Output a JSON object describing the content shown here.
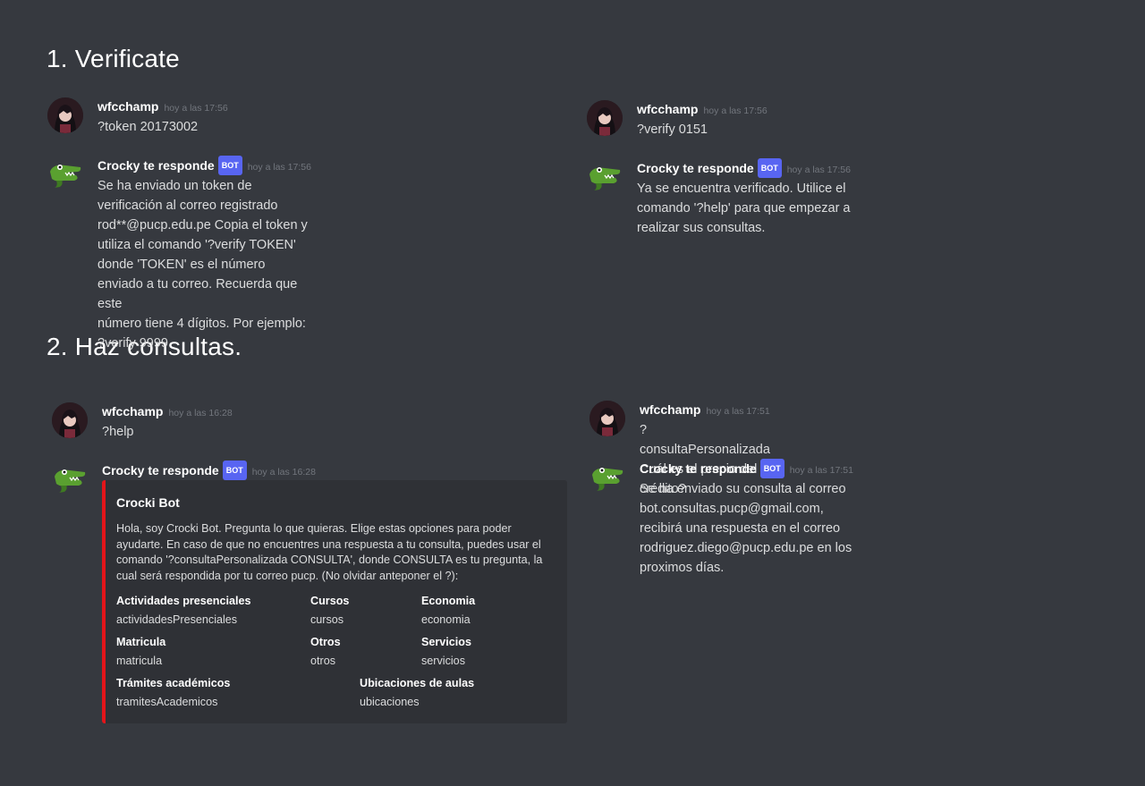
{
  "sections": [
    {
      "title": "1. Verificate"
    },
    {
      "title": "2. Haz consultas."
    }
  ],
  "user": {
    "name": "wfcchamp",
    "avatar_icon": "user-avatar-icon"
  },
  "bot": {
    "name": "Crocky te responde",
    "tag": "BOT",
    "avatar_icon": "crocodile-avatar-icon"
  },
  "colors": {
    "background": "#36393f",
    "embed_bg": "#2f3136",
    "embed_accent": "#e3151a",
    "bot_tag": "#5865f2",
    "timestamp": "#72767d"
  },
  "verify_left": {
    "user_time": "hoy a las 17:56",
    "user_text": "?token 20173002",
    "bot_time": "hoy a las 17:56",
    "bot_text": "Se ha enviado un token de verificación al correo registrado\nrod**@pucp.edu.pe Copia el token y utiliza el comando '?verify TOKEN'\ndonde 'TOKEN' es el número enviado a tu correo. Recuerda que este\nnúmero tiene 4 dígitos. Por ejemplo:\n?verify 9999"
  },
  "verify_right": {
    "user_time": "hoy a las 17:56",
    "user_text": "?verify 0151",
    "bot_time": "hoy a las 17:56",
    "bot_text": "Ya se encuentra verificado. Utilice el comando '?help' para que empezar a\nrealizar sus consultas."
  },
  "help_left": {
    "user_time": "hoy a las 16:28",
    "user_text": "?help",
    "bot_time": "hoy a las 16:28",
    "embed": {
      "title": "Crocki Bot",
      "description": "Hola, soy Crocki Bot. Pregunta lo que quieras. Elige estas opciones para poder ayudarte. En caso de que no encuentres una respuesta a tu consulta, puedes usar el comando '?consultaPersonalizada CONSULTA', donde CONSULTA es tu pregunta, la cual será respondida por tu correo pucp. (No olvidar anteponer el ?):",
      "fields": [
        {
          "name": "Actividades presenciales",
          "value": "actividadesPresenciales"
        },
        {
          "name": "Cursos",
          "value": "cursos"
        },
        {
          "name": "Economia",
          "value": "economia"
        },
        {
          "name": "Matricula",
          "value": "matricula"
        },
        {
          "name": "Otros",
          "value": "otros"
        },
        {
          "name": "Servicios",
          "value": "servicios"
        },
        {
          "name": "Trámites académicos",
          "value": "tramitesAcademicos"
        },
        {
          "name": "Ubicaciones de aulas",
          "value": "ubicaciones"
        }
      ]
    }
  },
  "consulta_right": {
    "user_time": "hoy a las 17:51",
    "user_text": "?consultaPersonalizada Cuál es el precio del crédito?",
    "bot_time": "hoy a las 17:51",
    "bot_text": "Se ha enviado su consulta al correo bot.consultas.pucp@gmail.com,\nrecibirá una respuesta en el correo rodriguez.diego@pucp.edu.pe en los\nproximos días."
  }
}
